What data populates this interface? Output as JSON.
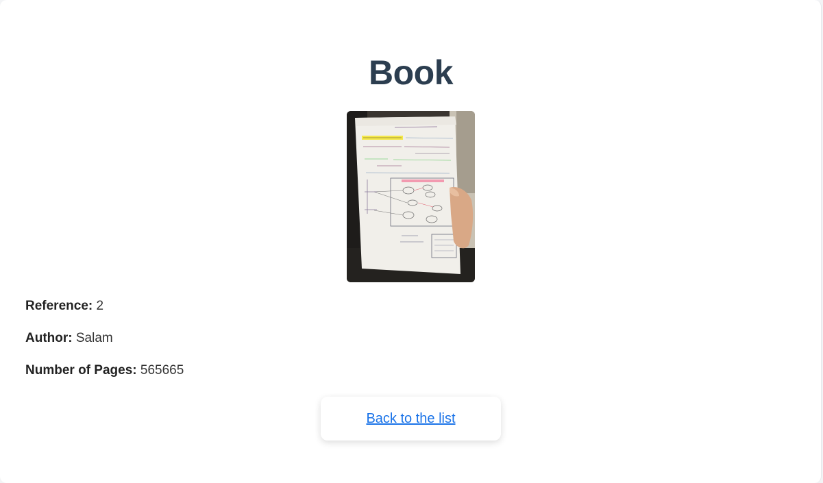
{
  "page": {
    "title": "Book"
  },
  "book": {
    "cover_alt": "Book cover photo of handwritten UML notes",
    "reference_label": "Reference:",
    "reference_value": "2",
    "author_label": "Author:",
    "author_value": "Salam",
    "pages_label": "Number of Pages:",
    "pages_value": "565665"
  },
  "actions": {
    "back_label": "Back to the list"
  },
  "colors": {
    "title": "#2c3e50",
    "link": "#1a73e8",
    "text": "#333333"
  }
}
